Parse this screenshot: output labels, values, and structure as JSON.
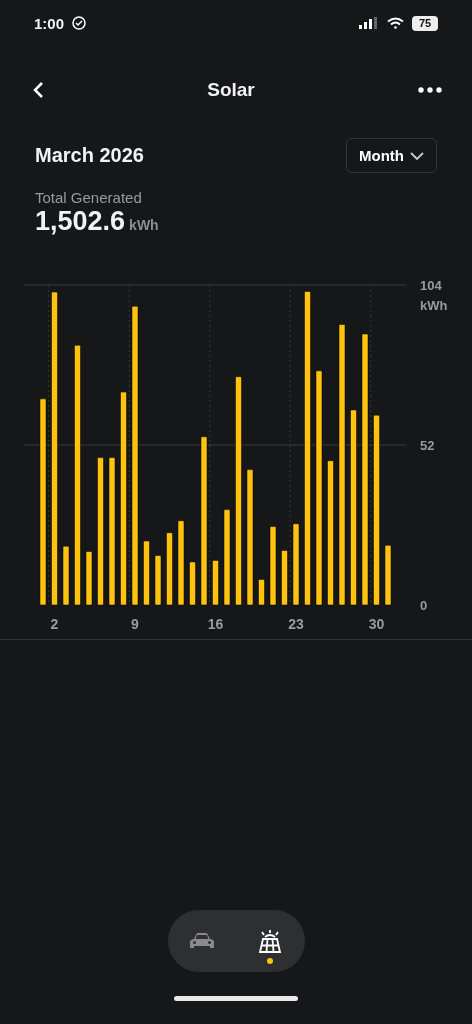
{
  "status_bar": {
    "time": "1:00",
    "battery": "75"
  },
  "header": {
    "title": "Solar"
  },
  "period": {
    "label": "March 2026",
    "selector": "Month"
  },
  "total": {
    "label": "Total Generated",
    "value": "1,502.6",
    "unit": "kWh"
  },
  "chart_data": {
    "type": "bar",
    "ylabel": "kWh",
    "x": [
      1,
      2,
      3,
      4,
      5,
      6,
      7,
      8,
      9,
      10,
      11,
      12,
      13,
      14,
      15,
      16,
      17,
      18,
      19,
      20,
      21,
      22,
      23,
      24,
      25,
      26,
      27,
      28,
      29,
      30,
      31
    ],
    "series": [
      {
        "color": "#ffc20e",
        "values": [
          67.0,
          101.7,
          19.1,
          84.4,
          17.4,
          47.9,
          47.9,
          69.2,
          97.1,
          20.8,
          16.1,
          23.5,
          27.4,
          14.0,
          54.7,
          14.5,
          31.0,
          74.2,
          44.0,
          8.3,
          25.5,
          17.7,
          26.4,
          101.9,
          76.1,
          46.9,
          91.2,
          63.4,
          88.1,
          61.7,
          19.4
        ]
      }
    ],
    "xlim": [
      -0.7,
      32.6
    ],
    "ylim": [
      0,
      104
    ],
    "yticks": [
      0,
      52,
      104
    ],
    "xticks": [
      2,
      9,
      16,
      23,
      30
    ]
  },
  "nav": [
    {
      "kind": "car",
      "selected": false
    },
    {
      "kind": "solar",
      "selected": true
    }
  ]
}
